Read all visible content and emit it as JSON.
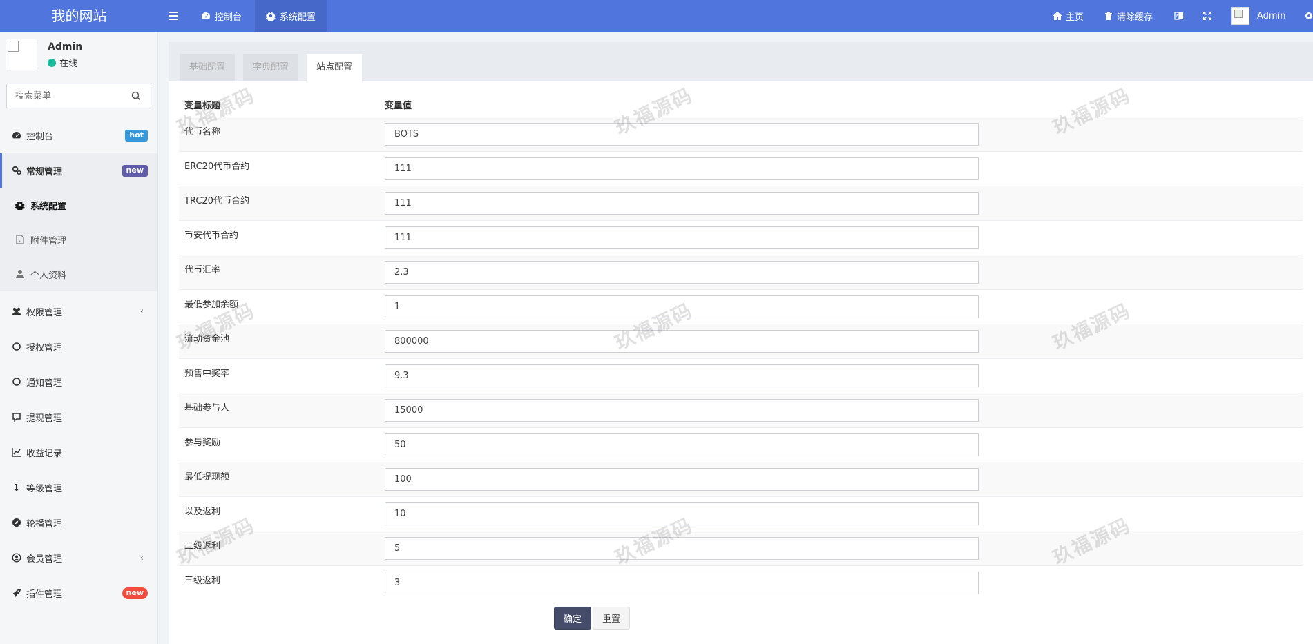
{
  "header": {
    "logo": "我的网站",
    "tabs": [
      {
        "label": "控制台",
        "icon": "dashboard-icon"
      },
      {
        "label": "系统配置",
        "icon": "gear-icon"
      }
    ],
    "right": {
      "home": "主页",
      "clear_cache": "清除缓存",
      "user": "Admin"
    }
  },
  "sidebar": {
    "user": {
      "name": "Admin",
      "status": "在线"
    },
    "search_placeholder": "搜索菜单",
    "items": [
      {
        "label": "控制台",
        "badge": "hot",
        "icon": "dashboard-icon"
      },
      {
        "label": "常规管理",
        "badge": "new",
        "icon": "cogs-icon"
      },
      {
        "label": "系统配置",
        "icon": "gear-icon"
      },
      {
        "label": "附件管理",
        "icon": "file-image-icon"
      },
      {
        "label": "个人资料",
        "icon": "user-icon"
      },
      {
        "label": "权限管理",
        "icon": "users-icon"
      },
      {
        "label": "授权管理",
        "icon": "circle-icon"
      },
      {
        "label": "通知管理",
        "icon": "circle-icon"
      },
      {
        "label": "提现管理",
        "icon": "chat-icon"
      },
      {
        "label": "收益记录",
        "icon": "line-chart-icon"
      },
      {
        "label": "等级管理",
        "icon": "level-down-icon"
      },
      {
        "label": "轮播管理",
        "icon": "compass-icon"
      },
      {
        "label": "会员管理",
        "icon": "user-circle-icon"
      },
      {
        "label": "插件管理",
        "badge": "new",
        "icon": "rocket-icon"
      }
    ]
  },
  "content": {
    "tabs": [
      "基础配置",
      "字典配置",
      "站点配置"
    ],
    "columns": {
      "title": "变量标题",
      "value": "变量值"
    },
    "rows": [
      {
        "label": "代币名称",
        "value": "BOTS"
      },
      {
        "label": "ERC20代币合约",
        "value": "111"
      },
      {
        "label": "TRC20代币合约",
        "value": "111"
      },
      {
        "label": "币安代币合约",
        "value": "111"
      },
      {
        "label": "代币汇率",
        "value": "2.3"
      },
      {
        "label": "最低参加余额",
        "value": "1"
      },
      {
        "label": "流动资金池",
        "value": "800000"
      },
      {
        "label": "预售中奖率",
        "value": "9.3"
      },
      {
        "label": "基础参与人",
        "value": "15000"
      },
      {
        "label": "参与奖励",
        "value": "50"
      },
      {
        "label": "最低提现额",
        "value": "100"
      },
      {
        "label": "以及返利",
        "value": "10"
      },
      {
        "label": "二级返利",
        "value": "5"
      },
      {
        "label": "三级返利",
        "value": "3"
      }
    ],
    "buttons": {
      "ok": "确定",
      "reset": "重置"
    }
  },
  "watermark": "玖福源码",
  "colors": {
    "topbar": "#5075dc",
    "ok_button": "#444c69",
    "online": "#18bc9c"
  }
}
